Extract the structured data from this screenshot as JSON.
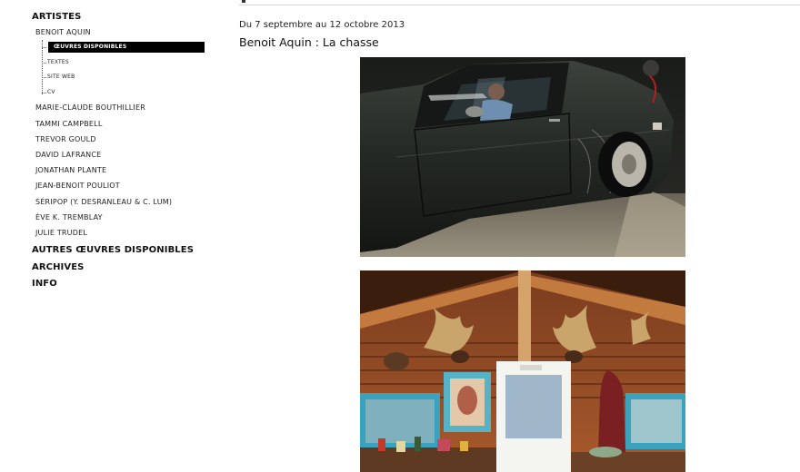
{
  "nav": {
    "artistes_label": "ARTISTES",
    "artists": [
      "BENOIT AQUIN",
      "MARIE-CLAUDE BOUTHILLIER",
      "TAMMI CAMPBELL",
      "TREVOR GOULD",
      "DAVID LAFRANCE",
      "JONATHAN PLANTE",
      "JEAN-BENOIT POULIOT",
      "SÉRIPOP (Y. DESRANLEAU & C. LUM)",
      "ÈVE K. TREMBLAY",
      "JULIE TRUDEL"
    ],
    "submenu": [
      {
        "label": "ŒUVRES DISPONIBLES",
        "active": true
      },
      {
        "label": "TEXTES",
        "active": false
      },
      {
        "label": "SITE WEB",
        "active": false
      },
      {
        "label": "CV",
        "active": false
      }
    ],
    "other_sections": [
      "AUTRES ŒUVRES DISPONIBLES",
      "ARCHIVES",
      "INFO"
    ]
  },
  "exhibition": {
    "dates": "Du 7 septembre au 12 octobre 2013",
    "title": "Benoit Aquin : La chasse"
  },
  "colors": {
    "active_bg": "#000000",
    "active_fg": "#ffffff"
  }
}
